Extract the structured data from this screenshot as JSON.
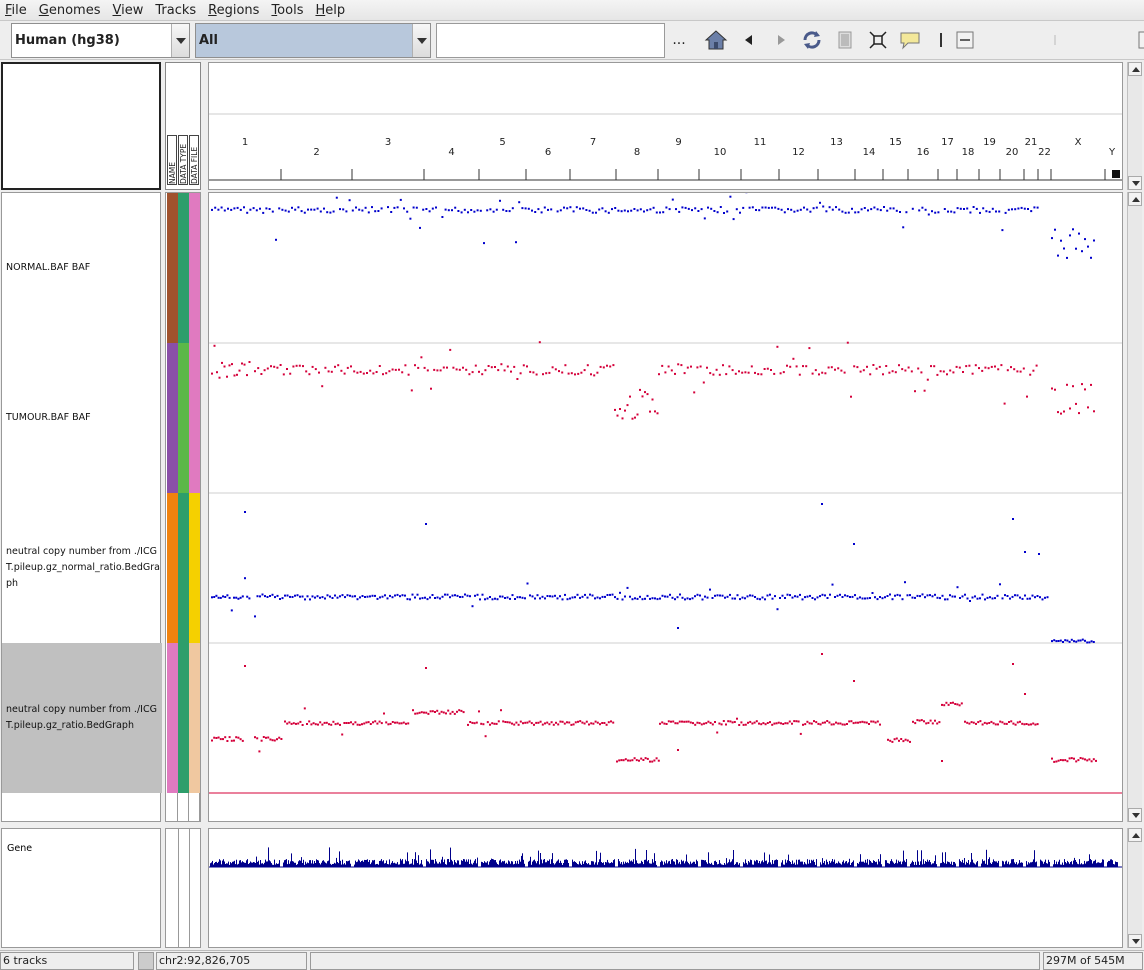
{
  "menu": [
    {
      "label": "File",
      "underline": "F",
      "rest": "ile"
    },
    {
      "label": "Genomes",
      "underline": "G",
      "rest": "enomes"
    },
    {
      "label": "View",
      "underline": "V",
      "rest": "iew"
    },
    {
      "label": "Tracks",
      "underline": "",
      "rest": "Tracks"
    },
    {
      "label": "Regions",
      "underline": "R",
      "rest": "egions"
    },
    {
      "label": "Tools",
      "underline": "T",
      "rest": "ools"
    },
    {
      "label": "Help",
      "underline": "H",
      "rest": "elp"
    }
  ],
  "toolbar": {
    "genome": "Human (hg38)",
    "chromosome": "All",
    "locus_value": "",
    "more_label": "...",
    "icons": [
      "home-icon",
      "back-icon",
      "forward-icon",
      "refresh-icon",
      "roi-icon",
      "resize-icon",
      "popup-text-icon",
      "ruler-divider-icon",
      "zoom-out-icon"
    ]
  },
  "attribute_headers": [
    "NAME",
    "DATA TYPE",
    "DATA FILE"
  ],
  "ruler": {
    "chromosomes": [
      "1",
      "2",
      "3",
      "4",
      "5",
      "6",
      "7",
      "8",
      "9",
      "10",
      "11",
      "12",
      "13",
      "14",
      "15",
      "16",
      "17",
      "18",
      "19",
      "20",
      "21",
      "22",
      "X",
      "Y"
    ]
  },
  "tracks": [
    {
      "name": "NORMAL.BAF BAF",
      "color": "#0000cc",
      "attr_colors": [
        "#a0522d",
        "#2e9e6b",
        "#e07ac0"
      ]
    },
    {
      "name": "TUMOUR.BAF BAF",
      "color": "#d4003a",
      "attr_colors": [
        "#8a4fa8",
        "#5cb848",
        "#e07ac0"
      ]
    },
    {
      "name": "neutral copy number from ./ICGT.pileup.gz_normal_ratio.BedGraph",
      "color": "#0000cc",
      "attr_colors": [
        "#f0820e",
        "#2e9e6b",
        "#f5d000"
      ]
    },
    {
      "name": "neutral copy number from ./ICGT.pileup.gz_ratio.BedGraph",
      "color": "#d4003a",
      "attr_colors": [
        "#e07ac0",
        "#2e9e6b",
        "#f0c8a0"
      ]
    }
  ],
  "gene_track": {
    "name": "Gene",
    "color": "#00008b"
  },
  "status": {
    "tracks": "6 tracks",
    "position": "chr2:92,826,705",
    "message": "",
    "memory": "297M of 545M"
  }
}
